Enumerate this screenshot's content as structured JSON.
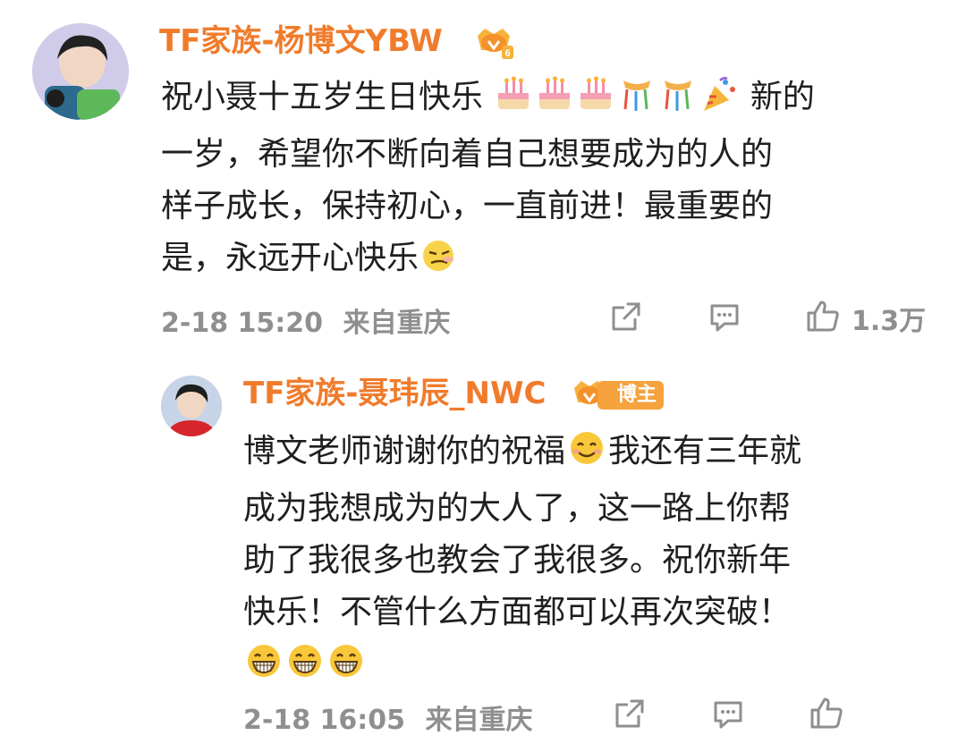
{
  "main_comment": {
    "username": "TF家族-杨博文YBW",
    "content_lines": [
      "祝小聂十五岁生日快乐",
      "新的",
      "一岁，希望你不断向着自己想要成为的人的",
      "样子成长，保持初心，一直前进！最重要的",
      "是，永远开心快乐"
    ],
    "emojis": [
      "cake-emoji",
      "cake-emoji",
      "cake-emoji",
      "ribbon-emoji",
      "ribbon-emoji",
      "party-popper-emoji",
      "smug-emoji"
    ],
    "timestamp": "2-18 15:20",
    "location": "来自重庆",
    "like_count": "1.3万",
    "icons": [
      "share-icon",
      "comment-icon",
      "like-icon"
    ]
  },
  "reply": {
    "username": "TF家族-聂玮辰_NWC",
    "badge_text": "博主",
    "content_lines": [
      "博文老师谢谢你的祝福",
      "我还有三年就",
      "成为我想成为的大人了，这一路上你帮",
      "助了我很多也教会了我很多。祝你新年",
      "快乐！不管什么方面都可以再次突破！"
    ],
    "emojis": [
      "smile-emoji",
      "grin-emoji",
      "grin-emoji",
      "grin-emoji"
    ],
    "timestamp": "2-18 16:05",
    "location": "来自重庆",
    "icons": [
      "share-icon",
      "comment-icon",
      "like-icon"
    ]
  },
  "colors": {
    "username": "#f07b2b",
    "text": "#1f1f1f",
    "meta": "#8f8f8f",
    "badge": "#f6a23d"
  }
}
